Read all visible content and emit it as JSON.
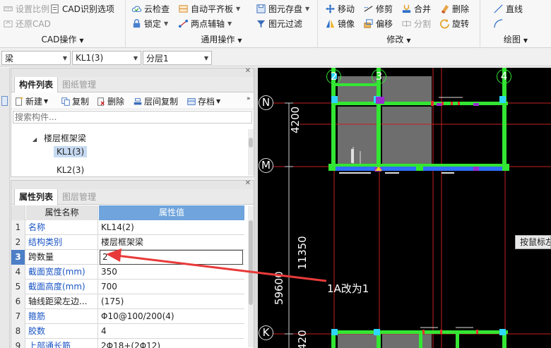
{
  "ribbon": {
    "cad_ops": {
      "label": "CAD操作",
      "set_scale": "设置比例",
      "restore_cad": "还原CAD",
      "cad_identify": "CAD识别选项"
    },
    "general_ops": {
      "label": "通用操作",
      "cloud_check": "云检查",
      "auto_level": "自动平齐板",
      "lock": "锁定",
      "two_point_axis": "两点辅轴",
      "save_disk": "图元存盘",
      "filter": "图元过滤"
    },
    "modify": {
      "label": "修改",
      "move": "移动",
      "trim": "修剪",
      "merge": "合并",
      "delete": "删除",
      "mirror": "镜像",
      "offset": "偏移",
      "split": "分割",
      "rotate": "旋转"
    },
    "draw": {
      "label": "绘图",
      "line": "直线"
    }
  },
  "dropbar": {
    "type_value": "梁",
    "component_value": "KL1(3)",
    "layer_value": "分层1"
  },
  "component_panel": {
    "tab_active": "构件列表",
    "tab_inactive": "图纸管理",
    "toolbar": {
      "new": "新建",
      "copy": "复制",
      "delete": "删除",
      "layer_copy": "层间复制",
      "save": "存档"
    },
    "search_placeholder": "搜索构件...",
    "tree": {
      "group": "楼层框架梁",
      "items": [
        "KL1(3)",
        "KL2(3)"
      ],
      "selected_index": 0
    }
  },
  "property_panel": {
    "tab_active": "属性列表",
    "tab_inactive": "图层管理",
    "headers": {
      "name": "属性名称",
      "value": "属性值"
    },
    "rows": [
      {
        "num": "1",
        "name": "名称",
        "value": "KL14(2)",
        "blue": true
      },
      {
        "num": "2",
        "name": "结构类别",
        "value": "楼层框架梁",
        "blue": true
      },
      {
        "num": "3",
        "name": "跨数量",
        "value": "2",
        "blue": false
      },
      {
        "num": "4",
        "name": "截面宽度(mm)",
        "value": "350",
        "blue": true
      },
      {
        "num": "5",
        "name": "截面高度(mm)",
        "value": "700",
        "blue": true
      },
      {
        "num": "6",
        "name": "轴线距梁左边...",
        "value": "(175)",
        "blue": false
      },
      {
        "num": "7",
        "name": "箍筋",
        "value": "Φ10@100/200(4)",
        "blue": true
      },
      {
        "num": "8",
        "name": "胶数",
        "value": "4",
        "blue": true
      },
      {
        "num": "9",
        "name": "上部通长筋",
        "value": "2Φ18+(2Φ12)",
        "blue": true
      }
    ],
    "selected_index": 2
  },
  "canvas": {
    "axis_top": [
      "2",
      "3",
      "4"
    ],
    "axis_side": [
      "N",
      "M",
      "K"
    ],
    "dims": [
      "4200",
      "11350",
      "59600",
      "420"
    ],
    "tooltip": "按鼠标左",
    "annotation": "1A改为1"
  },
  "colors": {
    "beam_green": "#33e633",
    "axis_red": "#c42020",
    "wall_blue": "#2f6fff",
    "column_cyan": "#2fd7ff",
    "node_purple": "#9b2cd1",
    "fill_gray": "#6e6e6e",
    "annotation_red": "#e83a3a",
    "header_blue": "#6fa4dc"
  }
}
